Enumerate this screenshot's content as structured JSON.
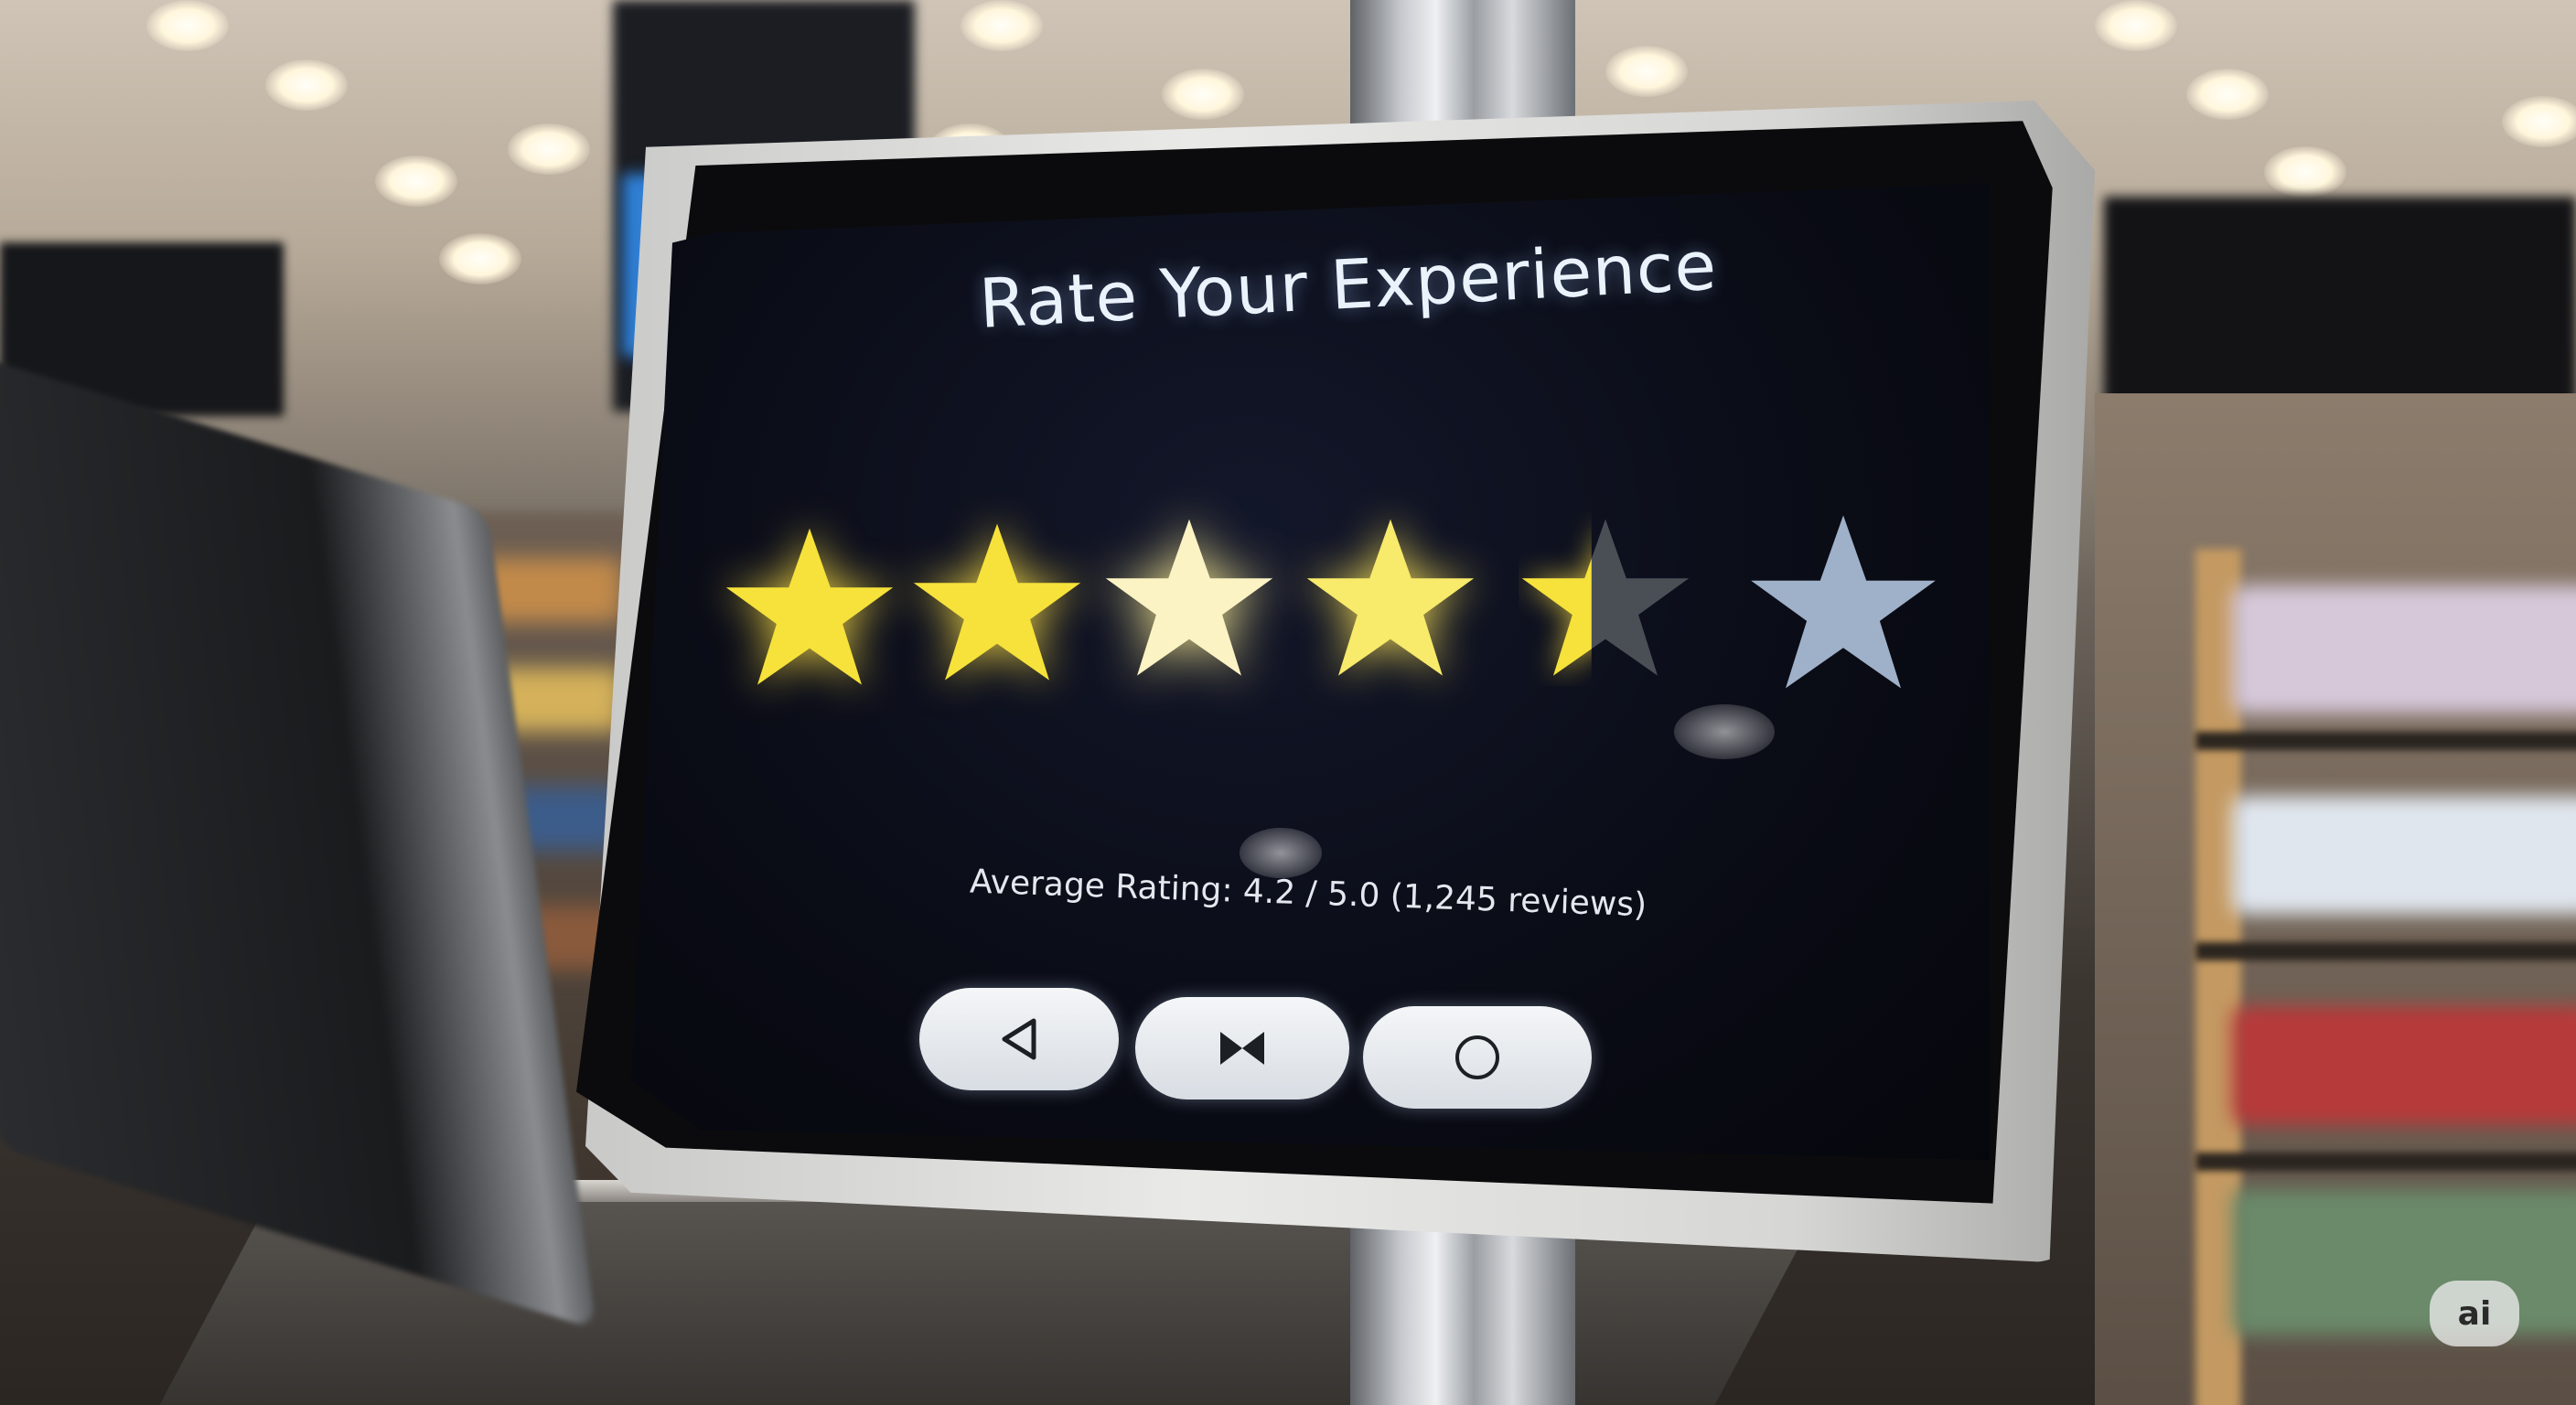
{
  "kiosk": {
    "title": "Rate Your Experience",
    "rating_summary": "Average Rating: 4.2 / 5.0 (1,245 reviews)",
    "rating": {
      "value": 4.2,
      "max": 5
    },
    "nav_buttons": [
      {
        "icon": "back-triangle-icon"
      },
      {
        "icon": "bowtie-icon"
      },
      {
        "icon": "circle-home-icon"
      }
    ]
  },
  "colors": {
    "star_filled": "#f6e23a",
    "star_empty": "#9fb1c8",
    "star_partial_dark": "#4a4f56",
    "screen_bg": "#0a0c16",
    "button_bg": "#e8ecf0"
  },
  "watermark": {
    "label": "ai"
  }
}
